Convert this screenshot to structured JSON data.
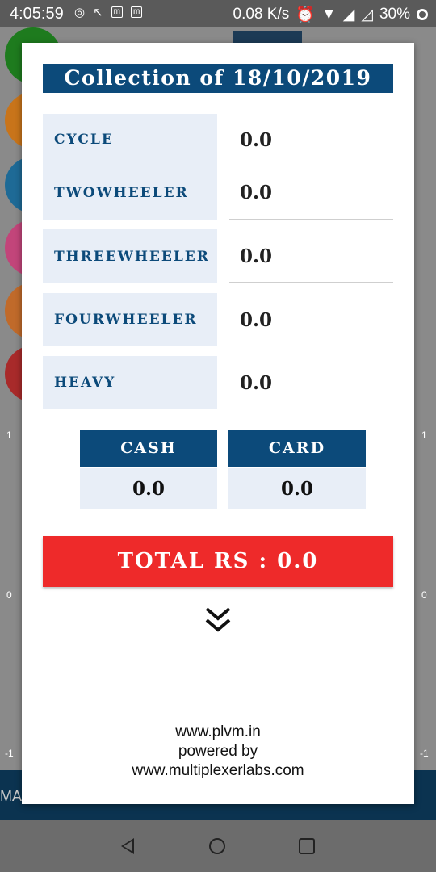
{
  "status_bar": {
    "time": "4:05:59",
    "box_icon_1": "m",
    "box_icon_2": "m",
    "speed": "0.08 K/s",
    "battery": "30%"
  },
  "background": {
    "axis_left": [
      "1",
      "0",
      "-1"
    ],
    "axis_right": [
      "1",
      "0",
      "-1"
    ],
    "strip_text": "MA"
  },
  "dialog": {
    "title": "Collection of 18/10/2019",
    "rows": [
      {
        "label": "CYCLE",
        "value": "0.0"
      },
      {
        "label": "TWOWHEELER",
        "value": "0.0"
      },
      {
        "label": "THREEWHEELER",
        "value": "0.0"
      },
      {
        "label": "FOURWHEELER",
        "value": "0.0"
      },
      {
        "label": "HEAVY",
        "value": "0.0"
      }
    ],
    "cash": {
      "label": "CASH",
      "value": "0.0"
    },
    "card": {
      "label": "CARD",
      "value": "0.0"
    },
    "total": "TOTAL RS : 0.0",
    "footer": [
      "www.plvm.in",
      "powered by",
      "www.multiplexerlabs.com"
    ]
  },
  "colors": {
    "accent": "#0c4a7a",
    "total_red": "#ee2a2a",
    "label_bg": "#e8eef7"
  }
}
